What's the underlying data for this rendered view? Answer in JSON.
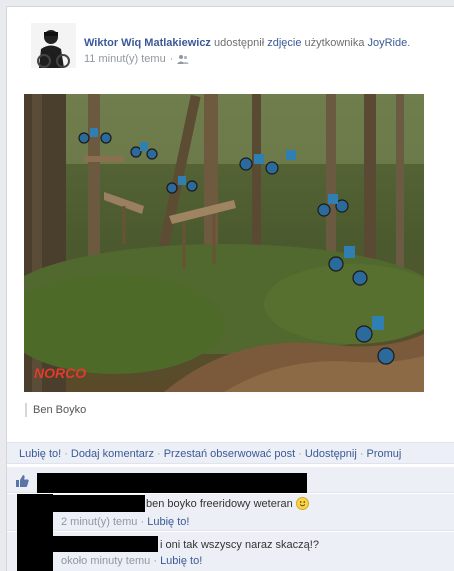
{
  "post": {
    "author": "Wiktor Wiq Matlakiewicz",
    "shared_text": "udostępnił",
    "photo_link": "zdjęcie",
    "of_user_text": "użytkownika",
    "source_page": "JoyRide",
    "time": "11 minut(y) temu",
    "dot": "·",
    "period": ".",
    "caption": "Ben Boyko",
    "watermark": "NORCO"
  },
  "actions": {
    "like": "Lubię to!",
    "comment": "Dodaj komentarz",
    "unfollow": "Przestań obserwować post",
    "share": "Udostępnij",
    "promote": "Promuj",
    "separator": "·"
  },
  "comments": [
    {
      "text": "ben boyko freeridowy weteran",
      "time": "2 minut(y) temu",
      "like": "Lubię to!",
      "emoticon": "smiley-icon"
    },
    {
      "text": "i oni tak wszyscy naraz skaczą!?",
      "time": "około minuty temu",
      "like": "Lubię to!"
    }
  ],
  "colors": {
    "link": "#3b5998",
    "panel": "#eceff5",
    "meta": "#9197a3"
  }
}
